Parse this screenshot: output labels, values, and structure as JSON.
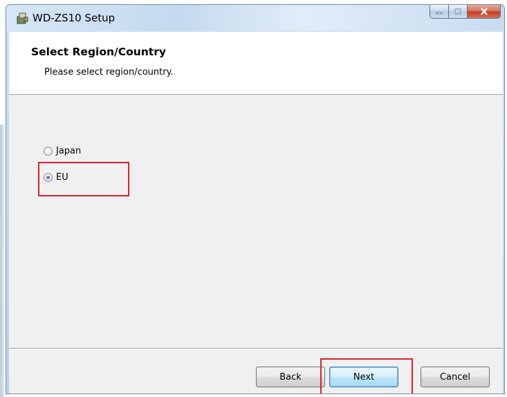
{
  "window": {
    "title": "WD-ZS10 Setup"
  },
  "header": {
    "title": "Select Region/Country",
    "subtitle": "Please select region/country."
  },
  "region_options": [
    {
      "label": "Japan",
      "selected": false
    },
    {
      "label": "EU",
      "selected": true
    }
  ],
  "buttons": {
    "back": "Back",
    "next": "Next",
    "cancel": "Cancel"
  },
  "colors": {
    "highlight": "#d8202b",
    "default_button": "#3c7fb1"
  }
}
